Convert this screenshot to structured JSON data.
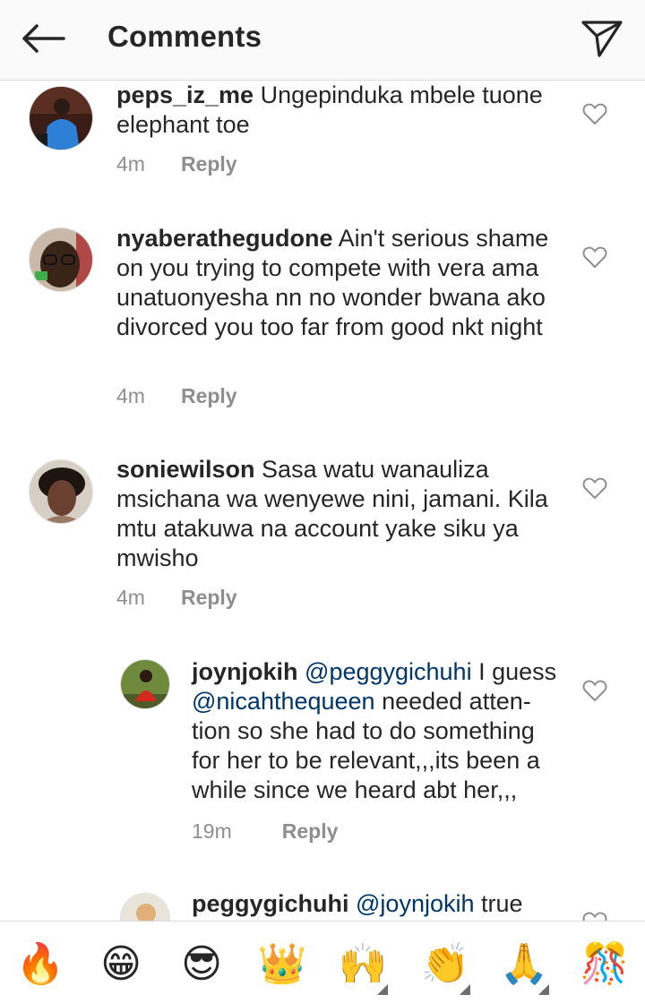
{
  "header": {
    "title": "Comments",
    "back_icon": "arrow-left-icon",
    "send_icon": "paper-plane-icon"
  },
  "comments": [
    {
      "username": "peps_iz_me",
      "text": "Ungepinduka mbele tuone elephant toe",
      "time": "4m",
      "reply": "Reply"
    },
    {
      "username": "nyaberathegudone",
      "text": "Ain't serious shame on you trying to compete with vera ama unatuonyesha  nn no wonder bwana ako divorced you too far from good nkt night",
      "time": "4m",
      "reply": "Reply"
    },
    {
      "username": "soniewilson",
      "text": "Sasa watu wanauliza msichana wa wenyewe nini, jamani. Kila mtu atakuwa na account yake siku ya mwisho",
      "time": "4m",
      "reply": "Reply"
    },
    {
      "username": "joynjokih",
      "mention1": "@peggygichuhi",
      "text1": " I guess ",
      "mention2": "@nicahthequeen",
      "text2": " needed atten-tion so she had to do something for her to be relevant,,,its been a while since we heard abt her,,,",
      "time": "19m",
      "reply": "Reply"
    },
    {
      "username": "peggygichuhi",
      "mention1": "@joynjokih",
      "text1": " true"
    }
  ],
  "emoji_bar": [
    {
      "name": "fire",
      "glyph": "🔥"
    },
    {
      "name": "grinning",
      "glyph": "😁"
    },
    {
      "name": "sunglasses",
      "glyph": "😎"
    },
    {
      "name": "crown",
      "glyph": "👑"
    },
    {
      "name": "raising-hands",
      "glyph": "🙌"
    },
    {
      "name": "clapping-hands",
      "glyph": "👏"
    },
    {
      "name": "folded-hands",
      "glyph": "🙏"
    },
    {
      "name": "confetti",
      "glyph": "🎊"
    }
  ],
  "colors": {
    "mention": "#003569",
    "meta": "#8e8e8e",
    "text": "#262626"
  }
}
